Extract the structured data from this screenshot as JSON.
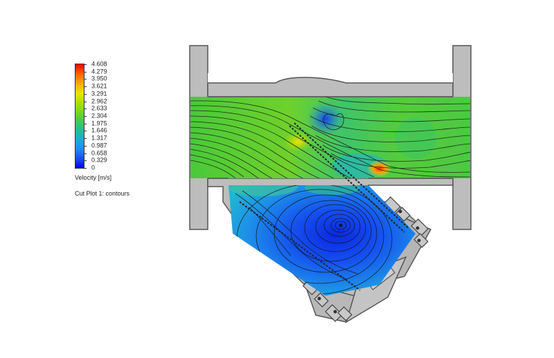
{
  "legend": {
    "ticks": [
      "4.608",
      "4.279",
      "3.950",
      "3.621",
      "3.291",
      "2.962",
      "2.633",
      "2.304",
      "1.975",
      "1.646",
      "1.317",
      "0.987",
      "0.658",
      "0.329",
      "0"
    ],
    "unit_label": "Velocity [m/s]",
    "caption": "Cut Plot 1: contours"
  },
  "colors": {
    "body_metal": "#bdbdbd",
    "outline": "#555555",
    "high_velocity": "#ff3300",
    "mid_velocity": "#5fd22e",
    "low_velocity": "#1b45f0"
  }
}
